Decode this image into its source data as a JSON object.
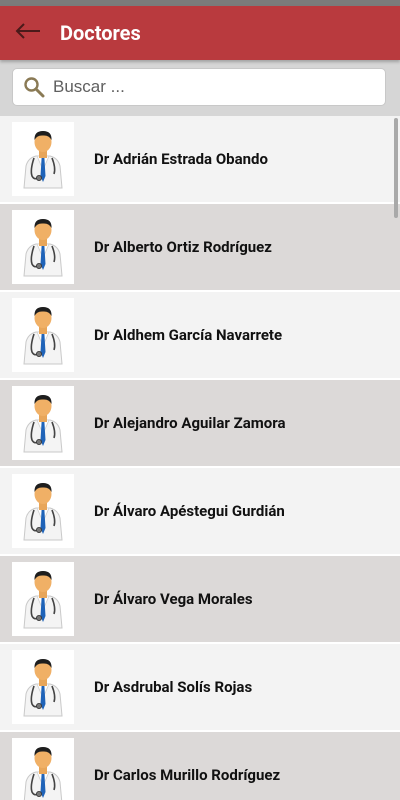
{
  "header": {
    "title": "Doctores",
    "back_icon": "arrow-left-icon",
    "color": "#b93a3e"
  },
  "search": {
    "placeholder": "Buscar ...",
    "value": "",
    "icon": "search-icon"
  },
  "doctors": [
    {
      "name": "Dr Adrián Estrada Obando"
    },
    {
      "name": "Dr Alberto Ortiz Rodríguez"
    },
    {
      "name": "Dr Aldhem García Navarrete"
    },
    {
      "name": "Dr Alejandro Aguilar Zamora"
    },
    {
      "name": "Dr Álvaro Apéstegui Gurdián"
    },
    {
      "name": "Dr Álvaro Vega Morales"
    },
    {
      "name": "Dr Asdrubal Solís Rojas"
    },
    {
      "name": "Dr Carlos Murillo Rodríguez"
    }
  ],
  "colors": {
    "row_light": "#f3f3f3",
    "row_dark": "#dcd9d8",
    "tie": "#1f63b8"
  }
}
